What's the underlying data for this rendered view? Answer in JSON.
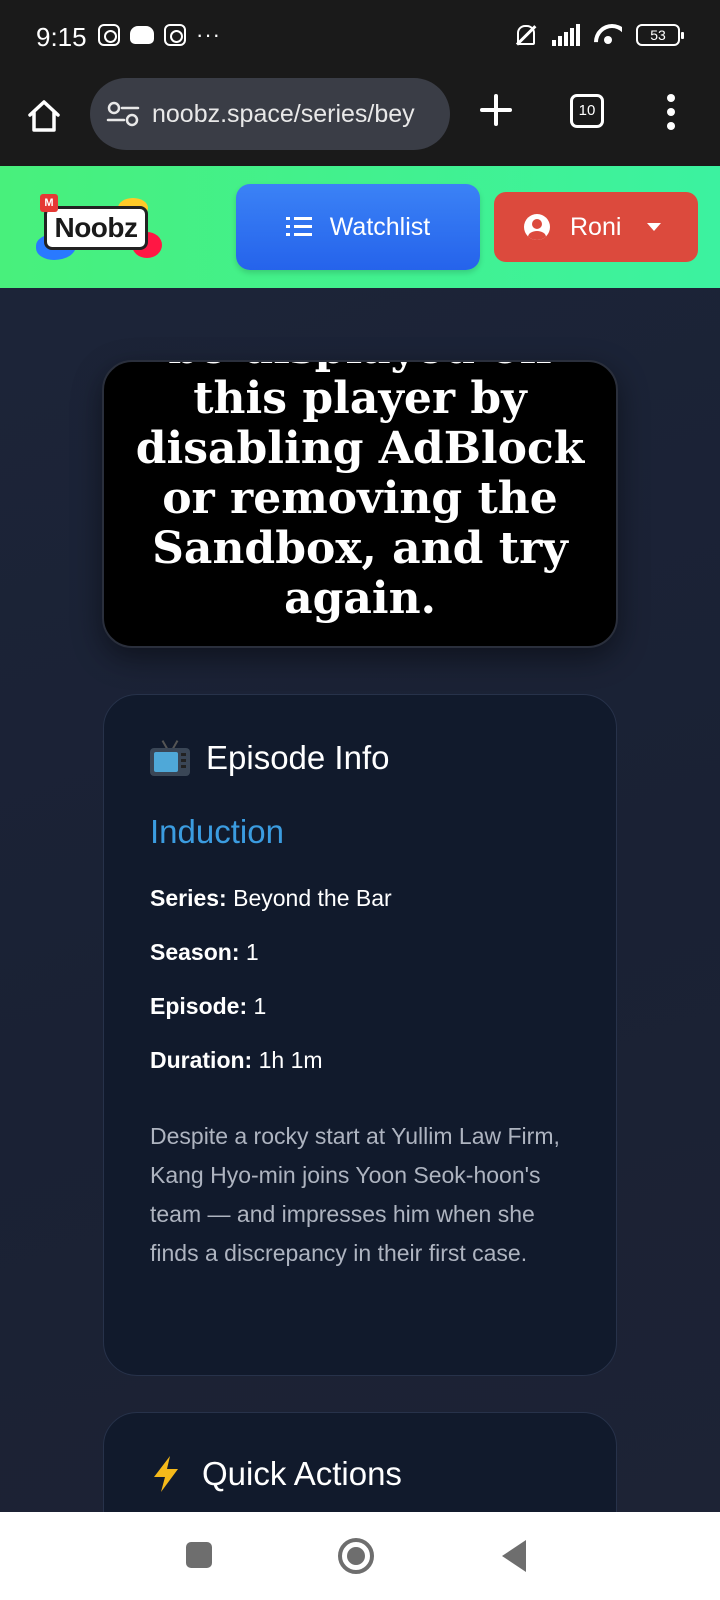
{
  "status_bar": {
    "time": "9:15",
    "dots": "···",
    "battery": "53"
  },
  "browser": {
    "url": "noobz.space/series/bey",
    "tab_count": "10"
  },
  "header": {
    "logo_text": "Noobz",
    "watchlist_label": "Watchlist",
    "user_label": "Roni",
    "colors": {
      "header_bg": "#48f07c",
      "watchlist_bg": "#3b82f6",
      "user_bg": "#dc4a3d"
    }
  },
  "player": {
    "message": "be displayed on this player by disabling AdBlock or removing the Sandbox, and try again."
  },
  "episode_info": {
    "heading": "Episode Info",
    "episode_title": "Induction",
    "series_label": "Series:",
    "series_value": "Beyond the Bar",
    "season_label": "Season:",
    "season_value": "1",
    "episode_label": "Episode:",
    "episode_value": "1",
    "duration_label": "Duration:",
    "duration_value": "1h 1m",
    "description": "Despite a rocky start at Yullim Law Firm, Kang Hyo-min joins Yoon Seok-hoon's team — and impresses him when she finds a discrepancy in their first case.",
    "accent_color": "#3b9ce0"
  },
  "quick_actions": {
    "heading": "Quick Actions"
  }
}
